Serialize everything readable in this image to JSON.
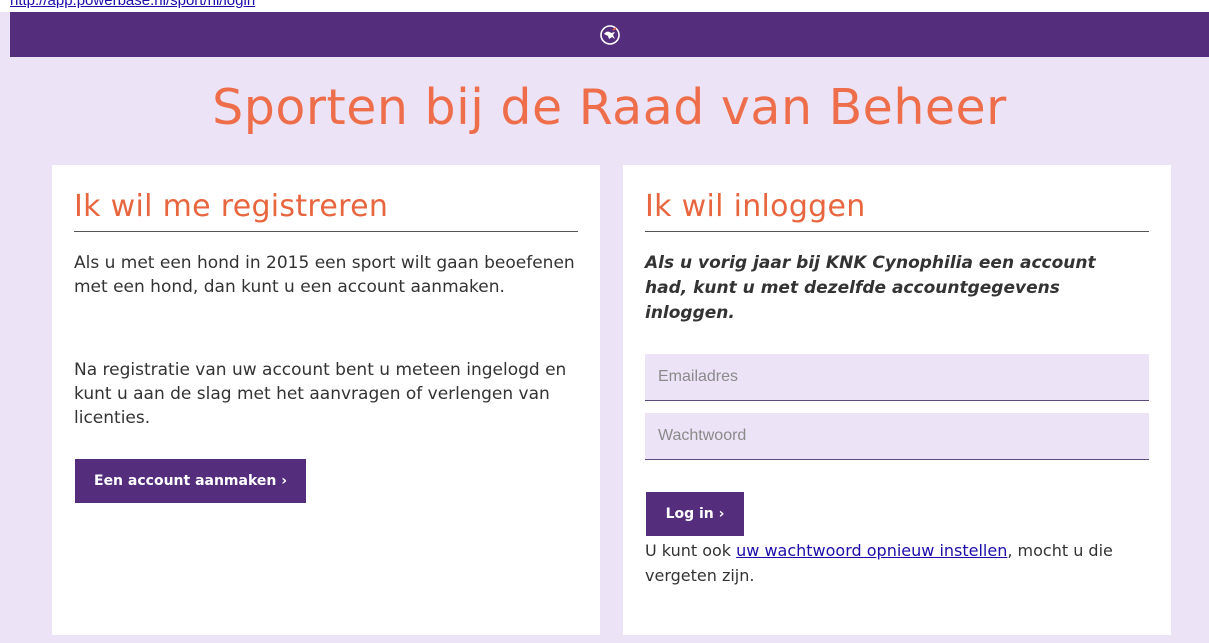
{
  "top_link": {
    "text": "http://app.powerbase.nl/sport/nl/login"
  },
  "header": {
    "logo_icon": "dog-logo-icon"
  },
  "page": {
    "title": "Sporten bij de Raad van Beheer"
  },
  "register": {
    "title": "Ik wil me registreren",
    "paragraph1": "Als u met een hond in 2015 een sport wilt gaan beoefenen met een hond, dan kunt u een account aanmaken.",
    "paragraph2": "Na registratie van uw account bent u meteen ingelogd en kunt u aan de slag met het aanvragen of verlengen van licenties.",
    "button_label": "Een account aanmaken ›"
  },
  "login": {
    "title": "Ik wil inloggen",
    "intro": "Als u vorig jaar bij KNK Cynophilia een account had, kunt u met dezelfde accountgegevens inloggen.",
    "email_placeholder": "Emailadres",
    "email_value": "",
    "password_placeholder": "Wachtwoord",
    "password_value": "",
    "button_label": "Log in ›",
    "help_prefix": "U kunt ook ",
    "help_link": "uw wachtwoord opnieuw instellen",
    "help_suffix": ", mocht u die vergeten zijn."
  },
  "colors": {
    "brand_purple": "#542e7d",
    "accent_orange": "#ee6e4c",
    "page_background": "#ece4f6",
    "link_blue": "#1a0dab"
  }
}
